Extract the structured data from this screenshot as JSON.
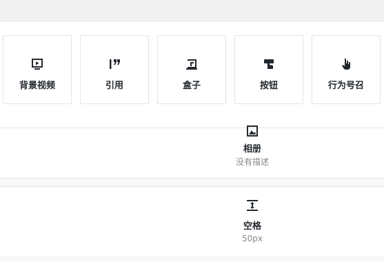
{
  "blocks": [
    {
      "label": "背景视频",
      "icon": "video-screen-icon"
    },
    {
      "label": "引用",
      "icon": "quote-icon"
    },
    {
      "label": "盒子",
      "icon": "box-icon"
    },
    {
      "label": "按钮",
      "icon": "button-icon"
    },
    {
      "label": "行为号召",
      "icon": "hand-pointer-icon"
    }
  ],
  "list": [
    {
      "title": "相册",
      "desc": "没有描述",
      "icon": "gallery-icon"
    },
    {
      "title": "空格",
      "desc": "50px",
      "icon": "spacer-icon"
    }
  ],
  "colors": {
    "text": "#23282d",
    "muted": "#888888",
    "border": "#e2e4e7",
    "scrollbar": "#dcdcdc"
  }
}
